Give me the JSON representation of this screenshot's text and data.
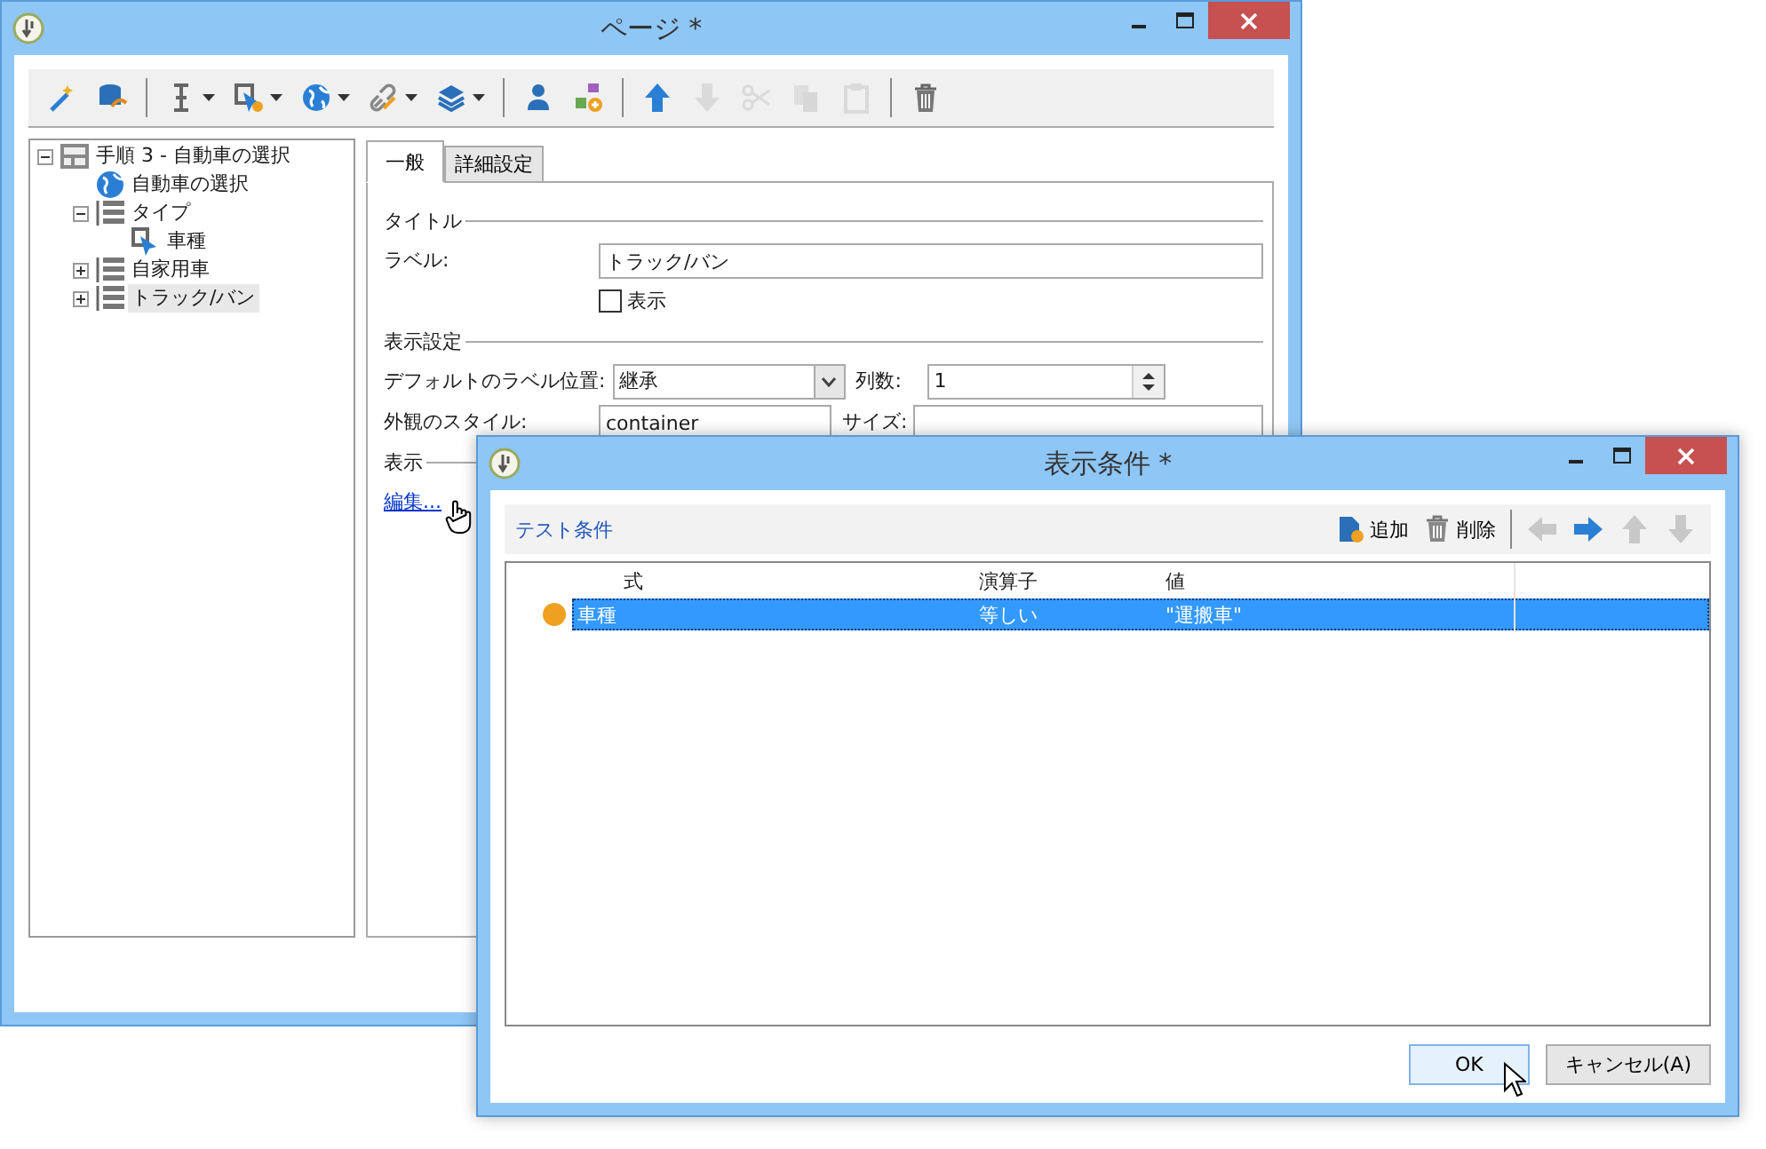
{
  "main_window": {
    "title": "ページ *",
    "toolbar": [
      {
        "kind": "wand",
        "disabled": false,
        "dropdown": false
      },
      {
        "kind": "database",
        "disabled": false,
        "dropdown": false
      },
      {
        "kind": "separator"
      },
      {
        "kind": "ibeam",
        "disabled": false,
        "dropdown": true
      },
      {
        "kind": "cursor-gear",
        "disabled": false,
        "dropdown": true
      },
      {
        "kind": "globe",
        "disabled": false,
        "dropdown": true
      },
      {
        "kind": "link",
        "disabled": false,
        "dropdown": true
      },
      {
        "kind": "layers",
        "disabled": false,
        "dropdown": true
      },
      {
        "kind": "separator"
      },
      {
        "kind": "person",
        "disabled": false,
        "dropdown": false
      },
      {
        "kind": "shapes",
        "disabled": false,
        "dropdown": false
      },
      {
        "kind": "separator"
      },
      {
        "kind": "up",
        "disabled": false,
        "dropdown": false
      },
      {
        "kind": "down",
        "disabled": true,
        "dropdown": false
      },
      {
        "kind": "scissors",
        "disabled": true,
        "dropdown": false
      },
      {
        "kind": "copy",
        "disabled": true,
        "dropdown": false
      },
      {
        "kind": "paste",
        "disabled": true,
        "dropdown": false
      },
      {
        "kind": "separator"
      },
      {
        "kind": "trash",
        "disabled": false,
        "dropdown": false
      }
    ],
    "tree": [
      {
        "label": "手順 3 - 自動車の選択",
        "kind": "page",
        "expanded": true,
        "selected": false,
        "children": [
          {
            "label": "自動車の選択",
            "kind": "globe",
            "selected": false
          },
          {
            "label": "タイプ",
            "kind": "list",
            "expanded": true,
            "selected": false,
            "children": [
              {
                "label": "車種",
                "kind": "cursor",
                "selected": false
              }
            ]
          },
          {
            "label": "自家用車",
            "kind": "list",
            "expanded": false,
            "selected": false
          },
          {
            "label": "トラック/バン",
            "kind": "list",
            "expanded": false,
            "selected": true
          }
        ]
      }
    ],
    "tabs": [
      {
        "label": "一般",
        "selected": true
      },
      {
        "label": "詳細設定",
        "selected": false
      }
    ],
    "sections": {
      "title": "タイトル",
      "display_settings": "表示設定",
      "display": "表示"
    },
    "label_field": {
      "label": "ラベル:",
      "value": "トラック/バン"
    },
    "show_checkbox": {
      "label": "表示",
      "checked": false
    },
    "default_label_position": {
      "label": "デフォルトのラベル位置:",
      "value": "継承"
    },
    "columns_field": {
      "label": "列数:",
      "value": "1"
    },
    "style_field": {
      "label": "外観のスタイル:",
      "value": "container"
    },
    "size_field": {
      "label": "サイズ:"
    },
    "edit_link": "編集..."
  },
  "dialog": {
    "title": "表示条件 *",
    "section_label": "テスト条件",
    "add_button": "追加",
    "delete_button": "削除",
    "nav": [
      {
        "kind": "left",
        "disabled": true
      },
      {
        "kind": "right",
        "disabled": false
      },
      {
        "kind": "up",
        "disabled": true
      },
      {
        "kind": "down",
        "disabled": true
      }
    ],
    "columns": [
      "式",
      "演算子",
      "値"
    ],
    "rows": [
      {
        "expression": "車種",
        "operator": "等しい",
        "value": "\"運搬車\"",
        "color": "#f0a020",
        "selected": true
      }
    ],
    "ok_button": "OK",
    "cancel_button": "キャンセル(A)"
  }
}
